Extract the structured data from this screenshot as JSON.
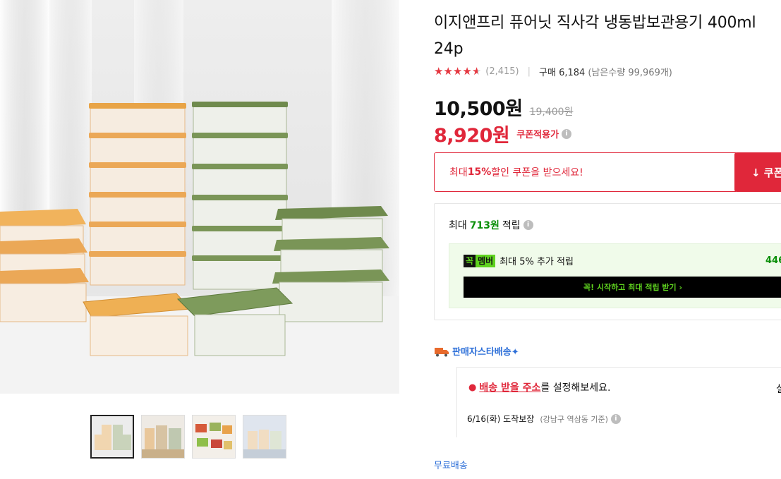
{
  "product": {
    "title": "이지앤프리 퓨어닛 직사각 냉동밥보관용기 400ml 24p",
    "review_count": "(2,415)",
    "sold": "구매 6,184",
    "remaining": "(남은수량 99,969개)",
    "rating": 4.5,
    "price": "10,500원",
    "original_price": "19,400원",
    "coupon_price": "8,920원",
    "coupon_label": "쿠폰적용가"
  },
  "coupon": {
    "prefix": "최대 ",
    "percent": "15%",
    "suffix": " 할인 쿠폰을 받으세요!",
    "button_label": "↓ 쿠폰"
  },
  "points": {
    "prefix": "최대",
    "amount": "713원",
    "suffix": "적립",
    "badge_left": "꼭",
    "badge_right": "멤버",
    "member_text": "최대 5% 추가 적립",
    "member_amount": "446",
    "cta": "꼭! 시작하고 최대 적립 받기 ›"
  },
  "delivery": {
    "type": "판매자스타배송✦",
    "address_link": "배송 받을 주소",
    "address_suffix": "를 설정해보세요.",
    "address_right": "설",
    "arrive": "6/16(화) 도착보장",
    "arrive_note": "(강남구 역삼동 기준)",
    "free": "무료배송"
  },
  "colors": {
    "accent_red": "#e0273a",
    "green": "#0a8f08",
    "blue": "#2d6fd8"
  },
  "icons": [
    "star-icon",
    "info-icon",
    "download-icon",
    "truck-icon",
    "location-pin-icon"
  ]
}
